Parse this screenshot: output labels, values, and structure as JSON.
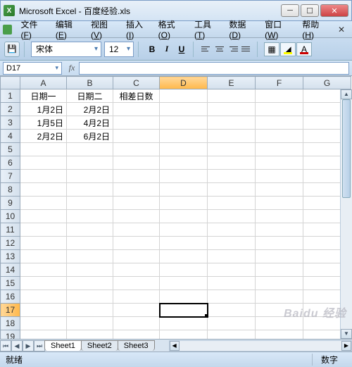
{
  "title": "Microsoft Excel - 百度经验.xls",
  "menu": [
    "文件(F)",
    "编辑(E)",
    "视图(V)",
    "插入(I)",
    "格式(O)",
    "工具(T)",
    "数据(D)",
    "窗口(W)",
    "帮助(H)"
  ],
  "toolbar": {
    "font_name": "宋体",
    "font_size": "12"
  },
  "namebox": "D17",
  "columns": [
    "A",
    "B",
    "C",
    "D",
    "E",
    "F",
    "G"
  ],
  "rows_count": 20,
  "selected_col": "D",
  "selected_row": 17,
  "active_cell": {
    "col": "D",
    "row": 17
  },
  "cells": {
    "A1": "日期一",
    "B1": "日期二",
    "C1": "相差日数",
    "A2": "1月2日",
    "B2": "2月2日",
    "A3": "1月5日",
    "B3": "4月2日",
    "A4": "2月2日",
    "B4": "6月2日"
  },
  "sheets": [
    "Sheet1",
    "Sheet2",
    "Sheet3"
  ],
  "active_sheet": "Sheet1",
  "status": {
    "left": "就绪",
    "right": "数字"
  },
  "watermark": "Baidu 经验"
}
